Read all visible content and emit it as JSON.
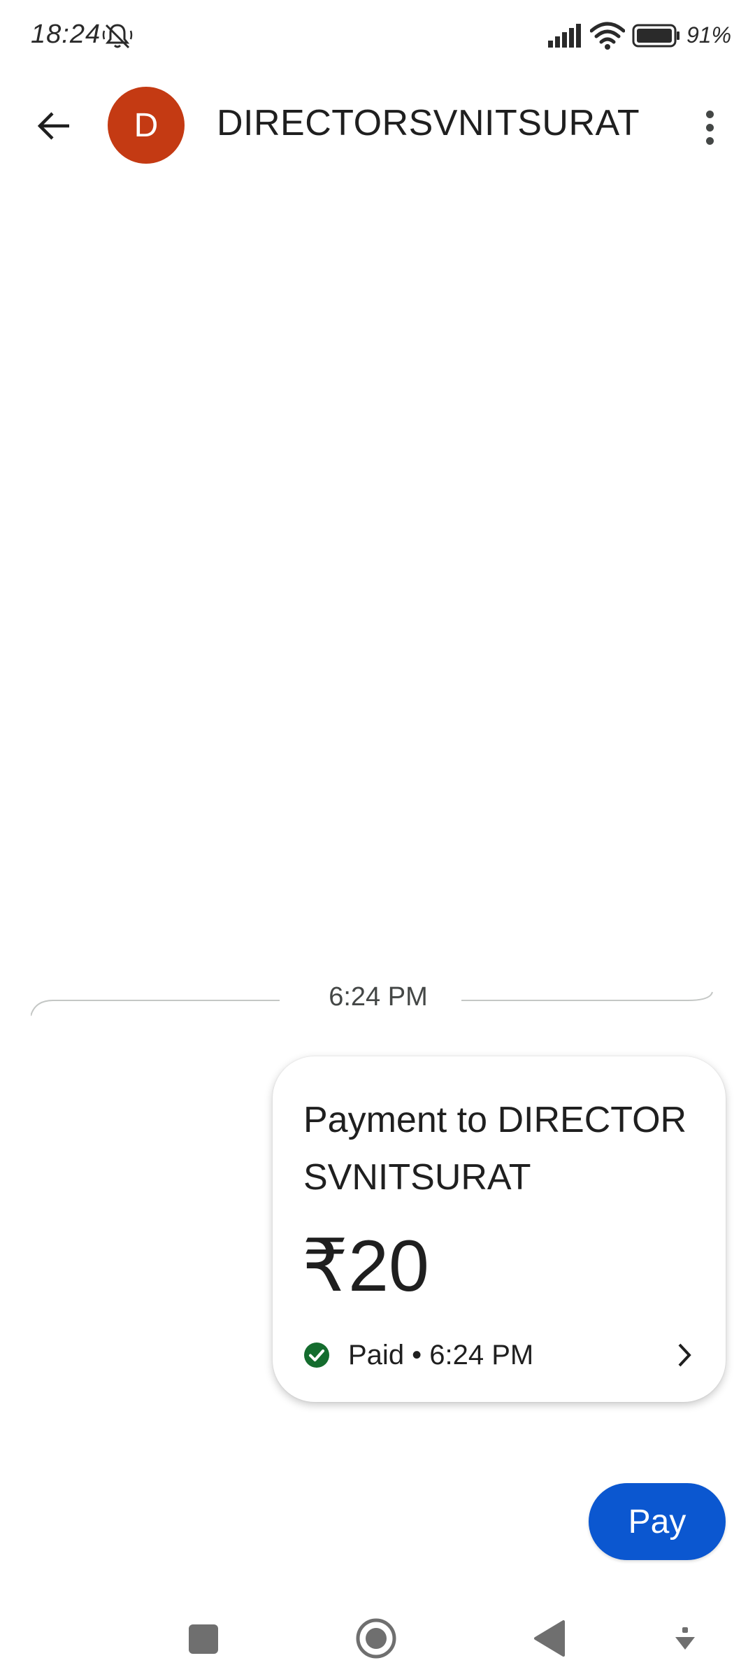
{
  "status_bar": {
    "time": "18:24",
    "battery": "91%",
    "icons": [
      "mute-icon",
      "signal-icon",
      "wifi-icon",
      "battery-icon"
    ]
  },
  "header": {
    "back_icon": "arrow-left-icon",
    "avatar_letter": "D",
    "avatar_color": "#c43a13",
    "contact_name": "DIRECTORSVNITSURAT",
    "menu_icon": "more-vert-icon"
  },
  "conversation": {
    "timestamp": "6:24 PM",
    "payment": {
      "title": "Payment to DIRECTORSVNITSURAT",
      "amount": "₹20",
      "status": "Paid • 6:24 PM",
      "status_color": "#146c2e"
    }
  },
  "actions": {
    "pay_label": "Pay",
    "pay_color": "#0b57d0"
  },
  "nav_bar": {
    "icons": [
      "recents-icon",
      "home-icon",
      "back-icon",
      "hide-keyboard-icon"
    ]
  }
}
